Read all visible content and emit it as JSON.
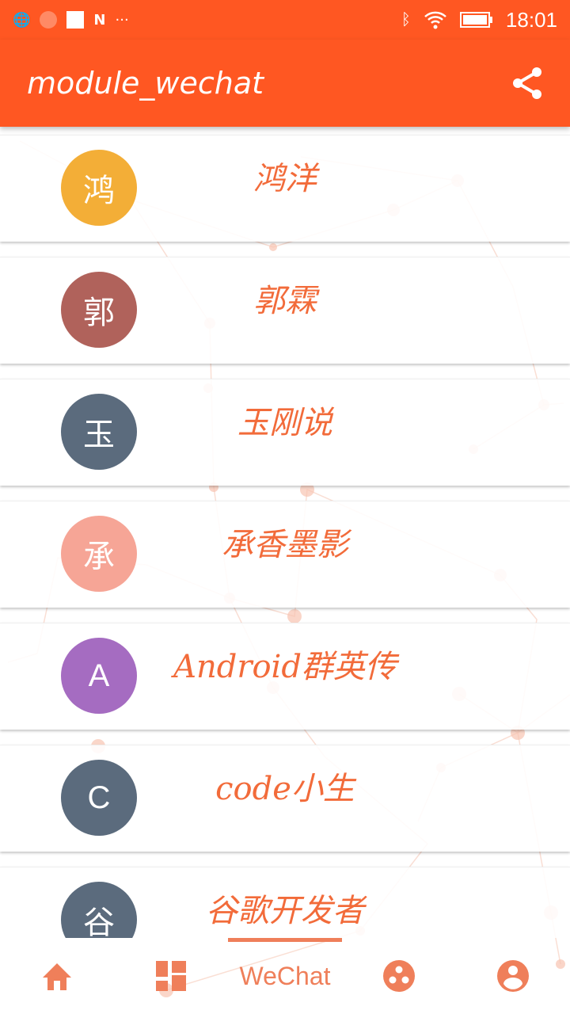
{
  "status": {
    "time": "18:01",
    "icons": [
      "globe-icon",
      "search-icon",
      "square-icon",
      "n-icon",
      "more-icon",
      "bluetooth-icon",
      "wifi-icon",
      "battery-icon"
    ]
  },
  "appbar": {
    "title": "module_wechat",
    "share_icon": "share-icon"
  },
  "colors": {
    "primary": "#ff5722",
    "accent": "#f26b3a"
  },
  "items": [
    {
      "avatar": "鸿",
      "name": "鸿洋",
      "color": "#f3ae37"
    },
    {
      "avatar": "郭",
      "name": "郭霖",
      "color": "#b0625b"
    },
    {
      "avatar": "玉",
      "name": "玉刚说",
      "color": "#5b6b7d"
    },
    {
      "avatar": "承",
      "name": "承香墨影",
      "color": "#f6a596"
    },
    {
      "avatar": "A",
      "name": "Android群英传",
      "color": "#a56cc1"
    },
    {
      "avatar": "C",
      "name": "code小生",
      "color": "#5b6b7d"
    },
    {
      "avatar": "谷",
      "name": "谷歌开发者",
      "color": "#5b6b7d"
    }
  ],
  "nav": {
    "active_label": "WeChat"
  }
}
